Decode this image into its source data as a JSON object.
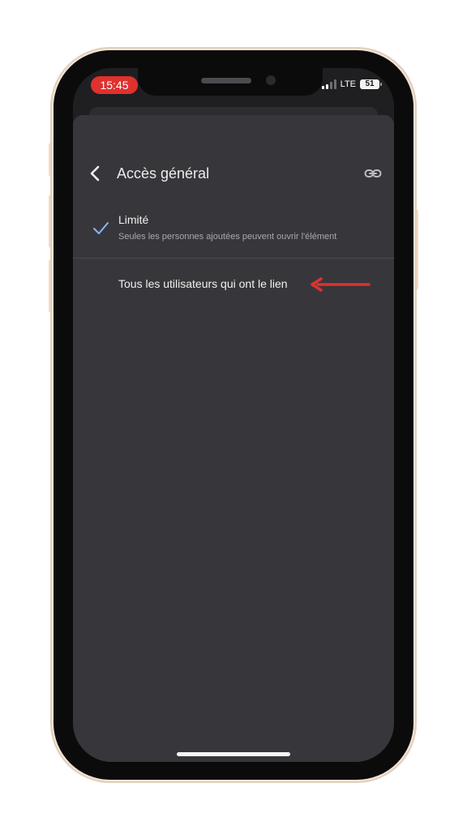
{
  "status_bar": {
    "time": "15:45",
    "network": "LTE",
    "battery": "51"
  },
  "header": {
    "title": "Accès général",
    "back_icon": "chevron-left-icon",
    "link_icon": "link-icon"
  },
  "options": [
    {
      "label": "Limité",
      "subtitle": "Seules les personnes ajoutées peuvent ouvrir l'élément",
      "selected": true
    },
    {
      "label": "Tous les utilisateurs qui ont le lien",
      "selected": false
    }
  ],
  "colors": {
    "sheet": "#37373b",
    "accent_check": "#8ab4f8",
    "annotation_arrow": "#e0312e",
    "time_pill": "#e0312e"
  },
  "annotation": {
    "icon": "red-arrow-left-icon"
  }
}
